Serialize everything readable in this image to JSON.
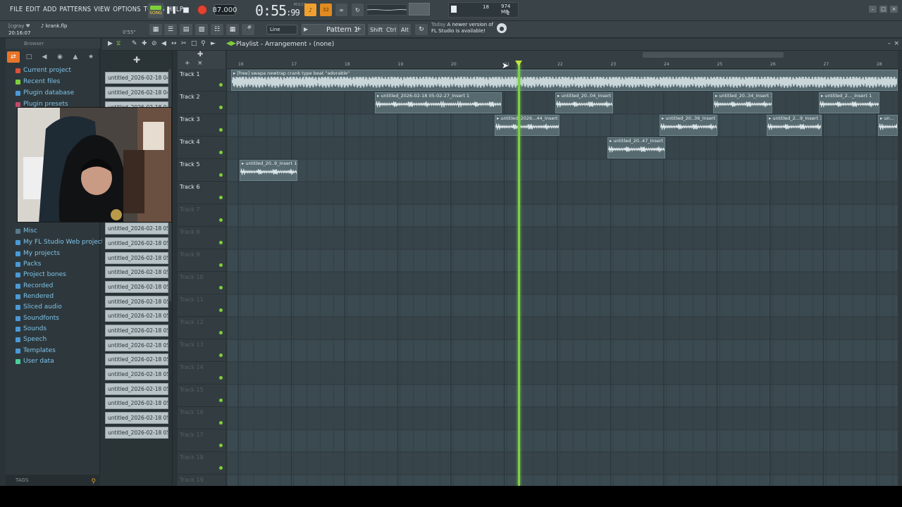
{
  "menu": [
    "FILE",
    "EDIT",
    "ADD",
    "PATTERNS",
    "VIEW",
    "OPTIONS",
    "TOOLS",
    "HELP"
  ],
  "transport": {
    "song_label": "SONG",
    "tempo": "87.000",
    "time_main": "0:55",
    "time_frac": "99",
    "time_unit": "M:S:CS"
  },
  "cpu": {
    "poly": "18",
    "mem": "974 MB",
    "cores": "2"
  },
  "project": {
    "user": "[cgray ♥",
    "file": "♪ krank.flp",
    "clock": "20:16:07",
    "duration": "0'55\""
  },
  "snap": "Line",
  "pattern": "Pattern 1",
  "keys": [
    "Shift",
    "Ctrl",
    "Alt"
  ],
  "news": {
    "label": "Today",
    "line1": "A newer version of",
    "line2": "FL Studio is available!"
  },
  "playlist": {
    "title": "Playlist - Arrangement",
    "sep": "›",
    "sub": "(none)"
  },
  "browser": {
    "header": "Browser",
    "items": [
      {
        "label": "Current project",
        "color": "#e0503a"
      },
      {
        "label": "Recent files",
        "color": "#7ecf3a"
      },
      {
        "label": "Plugin database",
        "color": "#4a9ad8"
      },
      {
        "label": "Plugin presets",
        "color": "#c04a6a"
      },
      {
        "label": "Misc",
        "color": "#5a7a8a"
      },
      {
        "label": "My FL Studio Web projects",
        "color": "#4a9ad8"
      },
      {
        "label": "My projects",
        "color": "#4a9ad8"
      },
      {
        "label": "Packs",
        "color": "#4a9ad8"
      },
      {
        "label": "Project bones",
        "color": "#4a9ad8"
      },
      {
        "label": "Recorded",
        "color": "#4a9ad8"
      },
      {
        "label": "Rendered",
        "color": "#4a9ad8"
      },
      {
        "label": "Sliced audio",
        "color": "#4a9ad8"
      },
      {
        "label": "Soundfonts",
        "color": "#4a9ad8"
      },
      {
        "label": "Sounds",
        "color": "#4a9ad8"
      },
      {
        "label": "Speech",
        "color": "#4a9ad8"
      },
      {
        "label": "Templates",
        "color": "#4a9ad8"
      },
      {
        "label": "User data",
        "color": "#4acf9a"
      }
    ],
    "tags": "TAGS"
  },
  "clips": [
    "untitled_2026-02-18 04-...",
    "untitled_2026-02-18 04-...",
    "untitled_2026-02-18 04-...",
    "untitled_2026-02-18 05-...",
    "untitled_2026-02-18 05-...",
    "untitled_2026-02-18 05-...",
    "untitled_2026-02-18 05-...",
    "untitled_2026-02-18 05-...",
    "untitled_2026-02-18 05-...",
    "untitled_2026-02-18 05-...",
    "untitled_2026-02-18 05-...",
    "untitled_2026-02-18 05-...",
    "untitled_2026-02-18 05-...",
    "untitled_2026-02-18 05-...",
    "untitled_2026-02-18 05-...",
    "untitled_2026-02-18 05-...",
    "untitled_2026-02-18 05-...",
    "untitled_2026-02-18 05-...",
    "untitled_2026-02-18 05-..."
  ],
  "tracks": [
    "Track 1",
    "Track 2",
    "Track 3",
    "Track 4",
    "Track 5",
    "Track 6",
    "Track 7",
    "Track 8",
    "Track 9",
    "Track 10",
    "Track 11",
    "Track 12",
    "Track 13",
    "Track 14",
    "Track 15",
    "Track 16",
    "Track 17",
    "Track 18",
    "Track 19"
  ],
  "ruler": [
    "16",
    "17",
    "18",
    "19",
    "20",
    "21",
    "22",
    "23",
    "24",
    "25",
    "26",
    "27",
    "28"
  ],
  "playlist_clips": [
    {
      "track": 0,
      "label": "[free] swapa  newtrap  crank type beat \"adorable\""
    },
    {
      "track": 1,
      "label": "untitled_2026-02-18 05-02-27_Insert 1"
    },
    {
      "track": 1,
      "label": "untitled_20..04_Insert 1"
    },
    {
      "track": 1,
      "label": "untitled_20..34_Insert 1"
    },
    {
      "track": 1,
      "label": "untitled_2..._Insert 1"
    },
    {
      "track": 2,
      "label": "untitled_2026...44_Insert 1"
    },
    {
      "track": 2,
      "label": "untitled_20..36_Insert 1"
    },
    {
      "track": 2,
      "label": "untitled_2...9_Insert 1"
    },
    {
      "track": 2,
      "label": "un..."
    },
    {
      "track": 3,
      "label": "untitled_20..47_Insert 1"
    },
    {
      "track": 4,
      "label": "untitled_20..9_Insert 1"
    }
  ],
  "colors": {
    "accent": "#e8752a",
    "playhead": "#7ed04a",
    "record": "#e4412f"
  }
}
